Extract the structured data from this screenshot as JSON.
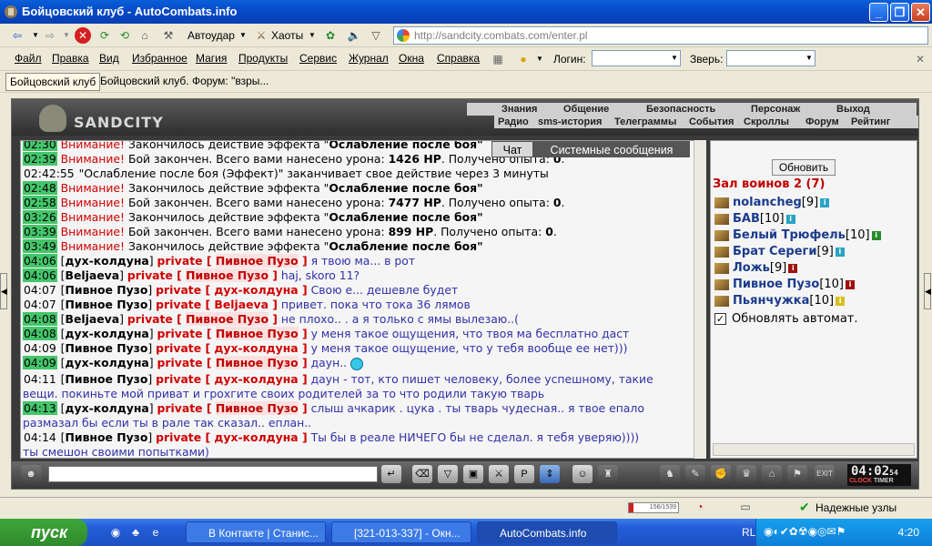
{
  "window": {
    "title": "Бойцовский клуб - AutoCombats.info"
  },
  "nav": {
    "autodar": "Автоудар",
    "haoty": "Хаоты",
    "url": "http://sandcity.combats.com/enter.pl"
  },
  "menu": [
    "Файл",
    "Правка",
    "Вид",
    "Избранное",
    "Магия",
    "Продукты",
    "Сервис",
    "Журнал",
    "Окна",
    "Справка"
  ],
  "login_label": "Логин:",
  "beast_label": "Зверь:",
  "tabs": [
    "Бойцовский клуб",
    "Бойцовский клуб. Форум: \"взры..."
  ],
  "game": {
    "logo": "SANDCITY",
    "top_nav": [
      "Знания",
      "Общение",
      "Безопасность",
      "Персонаж",
      "Выход"
    ],
    "sub_nav": [
      "Радио",
      "sms-история",
      "Телеграммы",
      "События",
      "Скроллы",
      "Форум",
      "Рейтинг"
    ],
    "chat_tabs": {
      "chat": "Чат",
      "system": "Системные сообщения"
    },
    "chat": [
      {
        "time": "02:30",
        "parts": [
          [
            "w",
            "Внимание! "
          ],
          [
            "",
            "Закончилось действие эффекта \""
          ],
          [
            "b",
            "Ослабление после боя\""
          ]
        ]
      },
      {
        "time": "02:39",
        "parts": [
          [
            "w",
            "Внимание! "
          ],
          [
            "",
            "Бой закончен. Всего вами нанесено урона: "
          ],
          [
            "b",
            "1426 HP"
          ],
          [
            "",
            "."
          ],
          [
            "",
            " Получено опыта: "
          ],
          [
            "b",
            "0"
          ],
          [
            "",
            "."
          ]
        ]
      },
      {
        "time": "02:42:55",
        "plain": true,
        "parts": [
          [
            "",
            "\"Ослабление после боя (Эффект)\" заканчивает свое действие через 3 минуты"
          ]
        ]
      },
      {
        "time": "02:48",
        "parts": [
          [
            "w",
            "Внимание! "
          ],
          [
            "",
            "Закончилось действие эффекта \""
          ],
          [
            "b",
            "Ослабление после боя\""
          ]
        ]
      },
      {
        "time": "02:58",
        "parts": [
          [
            "w",
            "Внимание! "
          ],
          [
            "",
            "Бой закончен. Всего вами нанесено урона: "
          ],
          [
            "b",
            "7477 HP"
          ],
          [
            "",
            ". Получено опыта: "
          ],
          [
            "b",
            "0"
          ],
          [
            "",
            "."
          ]
        ]
      },
      {
        "time": "03:26",
        "parts": [
          [
            "w",
            "Внимание! "
          ],
          [
            "",
            "Закончилось действие эффекта \""
          ],
          [
            "b",
            "Ослабление после боя\""
          ]
        ]
      },
      {
        "time": "03:39",
        "parts": [
          [
            "w",
            "Внимание! "
          ],
          [
            "",
            "Бой закончен. Всего вами нанесено урона: "
          ],
          [
            "b",
            "899 HP"
          ],
          [
            "",
            ". Получено опыта: "
          ],
          [
            "b",
            "0"
          ],
          [
            "",
            "."
          ]
        ]
      },
      {
        "time": "03:49",
        "parts": [
          [
            "w",
            "Внимание! "
          ],
          [
            "",
            "Закончилось действие эффекта \""
          ],
          [
            "b",
            "Ослабление после боя\""
          ]
        ]
      },
      {
        "time": "04:06",
        "parts": [
          [
            "",
            "["
          ],
          [
            "nick",
            "дух-колдуна"
          ],
          [
            "",
            "] "
          ],
          [
            "priv",
            "private [ "
          ],
          [
            "pnb",
            "Пивное Пузо"
          ],
          [
            "priv",
            " ]"
          ],
          [
            "msg",
            " я твою ма... в рот"
          ]
        ]
      },
      {
        "time": "04:06",
        "parts": [
          [
            "",
            "["
          ],
          [
            "nick",
            "Beljaeva"
          ],
          [
            "",
            "] "
          ],
          [
            "priv",
            "private [ "
          ],
          [
            "pnb",
            "Пивное Пузо"
          ],
          [
            "priv",
            " ]"
          ],
          [
            "msg",
            " haj, skoro 11?"
          ]
        ]
      },
      {
        "time": "04:07",
        "plain": true,
        "parts": [
          [
            "",
            "["
          ],
          [
            "nick",
            "Пивное Пузо"
          ],
          [
            "",
            "] "
          ],
          [
            "priv",
            "private [ дух-колдуна ]"
          ],
          [
            "msg",
            " Свою е... дешевле будет"
          ]
        ]
      },
      {
        "time": "04:07",
        "plain": true,
        "parts": [
          [
            "",
            "["
          ],
          [
            "nick",
            "Пивное Пузо"
          ],
          [
            "",
            "] "
          ],
          [
            "priv",
            "private [ Beljaeva ]"
          ],
          [
            "msg",
            " привет. пока что тока 36 лямов"
          ]
        ]
      },
      {
        "time": "04:08",
        "parts": [
          [
            "",
            "["
          ],
          [
            "nick",
            "Beljaeva"
          ],
          [
            "",
            "] "
          ],
          [
            "priv",
            "private [ "
          ],
          [
            "pnb",
            "Пивное Пузо"
          ],
          [
            "priv",
            " ]"
          ],
          [
            "msg",
            " не плохо.. . а я только с ямы вылезаю..("
          ]
        ]
      },
      {
        "time": "04:08",
        "parts": [
          [
            "",
            "["
          ],
          [
            "nick",
            "дух-колдуна"
          ],
          [
            "",
            "] "
          ],
          [
            "priv",
            "private [ "
          ],
          [
            "pnb",
            "Пивное Пузо"
          ],
          [
            "priv",
            " ]"
          ],
          [
            "msg",
            " у меня такое ощущения, что твоя ма бесплатно даст"
          ]
        ]
      },
      {
        "time": "04:09",
        "plain": true,
        "parts": [
          [
            "",
            "["
          ],
          [
            "nick",
            "Пивное Пузо"
          ],
          [
            "",
            "] "
          ],
          [
            "priv",
            "private [ дух-колдуна ]"
          ],
          [
            "msg",
            " у меня такое ощущение, что у тебя вообще ее нет)))"
          ]
        ]
      },
      {
        "time": "04:09",
        "smile": true,
        "parts": [
          [
            "",
            "["
          ],
          [
            "nick",
            "дух-колдуна"
          ],
          [
            "",
            "] "
          ],
          [
            "priv",
            "private [ "
          ],
          [
            "pnb",
            "Пивное Пузо"
          ],
          [
            "priv",
            " ]"
          ],
          [
            "msg",
            " даун.."
          ]
        ]
      },
      {
        "time": "04:11",
        "plain": true,
        "parts": [
          [
            "",
            "["
          ],
          [
            "nick",
            "Пивное Пузо"
          ],
          [
            "",
            "] "
          ],
          [
            "priv",
            "private [ дух-колдуна ]"
          ],
          [
            "msg",
            " даун - тот, кто пишет человеку, более успешному, такие"
          ]
        ]
      },
      {
        "cont": true,
        "parts": [
          [
            "msg",
            "вещи. покиньте мой приват и грохгите своих родителей за то что родили такую тварь"
          ]
        ]
      },
      {
        "time": "04:13",
        "parts": [
          [
            "",
            "["
          ],
          [
            "nick",
            "дух-колдуна"
          ],
          [
            "",
            "] "
          ],
          [
            "priv",
            "private [ "
          ],
          [
            "pnb",
            "Пивное Пузо"
          ],
          [
            "priv",
            " ]"
          ],
          [
            "msg",
            " слыш ачкарик . цука . ты тварь чудесная.. я твое епало"
          ]
        ]
      },
      {
        "cont": true,
        "parts": [
          [
            "msg",
            "размазал бы если ты в рале так сказал.. еплан.."
          ]
        ]
      },
      {
        "time": "04:14",
        "plain": true,
        "parts": [
          [
            "",
            "["
          ],
          [
            "nick",
            "Пивное Пузо"
          ],
          [
            "",
            "] "
          ],
          [
            "priv",
            "private [ дух-колдуна ]"
          ],
          [
            "msg",
            " Ты бы в реале НИЧЕГО бы не сделал. я тебя уверяю))))"
          ]
        ]
      },
      {
        "cont": true,
        "parts": [
          [
            "msg",
            "ты смешон своими попытками)"
          ]
        ]
      }
    ],
    "right": {
      "refresh": "Обновить",
      "room": "Зал воинов 2 (7)",
      "users": [
        {
          "name": "nolancheg",
          "level": "[9]",
          "badge": "i"
        },
        {
          "name": "БАВ",
          "level": "[10]",
          "badge": "i"
        },
        {
          "name": "Белый Трюфель",
          "level": "[10]",
          "badge": "g"
        },
        {
          "name": "Брат Сереги",
          "level": "[9]",
          "badge": "i"
        },
        {
          "name": "Ложь",
          "level": "[9]",
          "badge": "r"
        },
        {
          "name": "Пивное Пузо",
          "level": "[10]",
          "badge": "r"
        },
        {
          "name": "Пьянчужка",
          "level": "[10]",
          "badge": "y"
        }
      ],
      "autorefresh": "Обновлять автомат."
    },
    "clock": {
      "time": "04:02",
      "sec": "54",
      "lbl_clock": "CLOCK",
      "lbl_timer": "TIMER"
    }
  },
  "status": {
    "progress_text": "156/1539",
    "progress": 0.1,
    "reliable": "Надежные узлы"
  },
  "taskbar": {
    "start": "пуск",
    "items": [
      "В Контакте | Станис...",
      "[321-013-337] - Окн...",
      "AutoCombats.info"
    ],
    "lang": "RL",
    "time": "4:20"
  }
}
